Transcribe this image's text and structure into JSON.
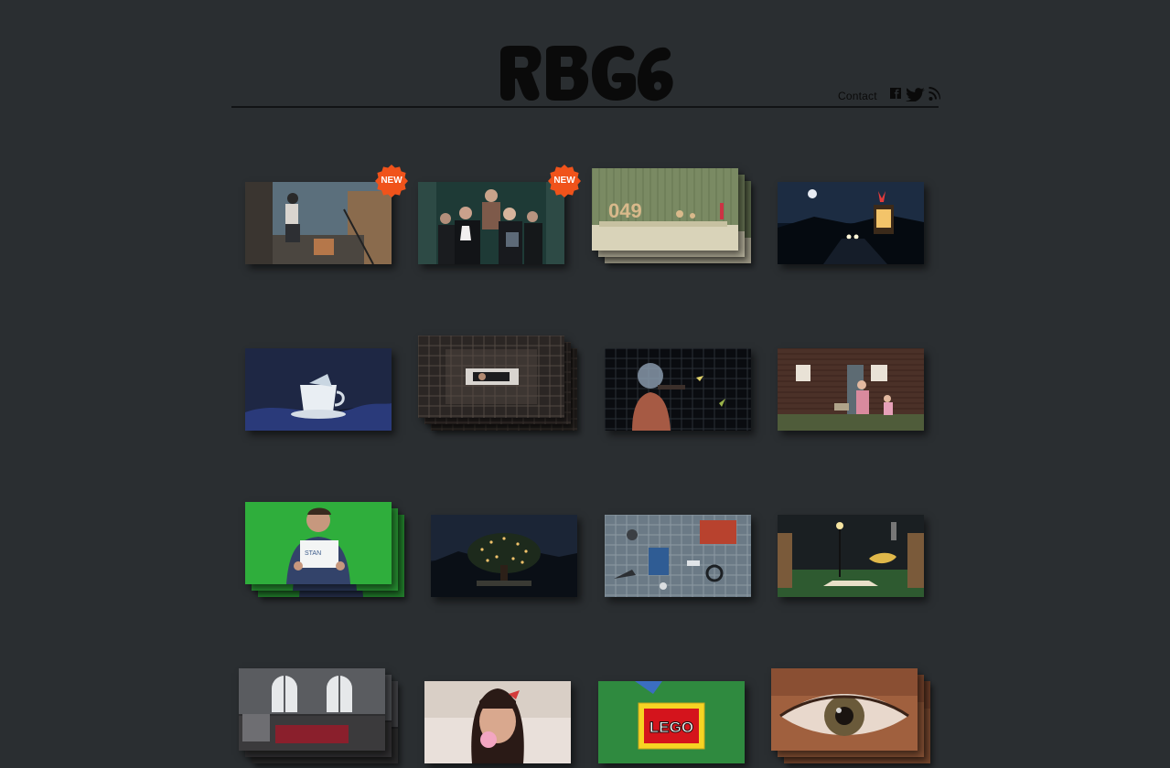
{
  "header": {
    "logo_alt": "RBG6",
    "contact_label": "Contact",
    "social": [
      {
        "name": "facebook-icon"
      },
      {
        "name": "twitter-icon"
      },
      {
        "name": "rss-icon"
      }
    ]
  },
  "badge_label": "NEW",
  "colors": {
    "background": "#2a2e31",
    "rule": "#111315",
    "badge": "#f0531b"
  },
  "thumbnails": [
    {
      "id": "thumb-1",
      "new": true,
      "stack": false,
      "scene": "window-painter"
    },
    {
      "id": "thumb-2",
      "new": true,
      "stack": false,
      "scene": "group-portrait"
    },
    {
      "id": "thumb-3",
      "new": false,
      "stack": true,
      "scene": "number-table"
    },
    {
      "id": "thumb-4",
      "new": false,
      "stack": false,
      "scene": "night-road"
    },
    {
      "id": "thumb-5",
      "new": false,
      "stack": false,
      "scene": "teacup"
    },
    {
      "id": "thumb-6",
      "new": false,
      "stack": true,
      "scene": "grid-room"
    },
    {
      "id": "thumb-7",
      "new": false,
      "stack": false,
      "scene": "diver-grid"
    },
    {
      "id": "thumb-8",
      "new": false,
      "stack": false,
      "scene": "family-house"
    },
    {
      "id": "thumb-9",
      "new": false,
      "stack": true,
      "scene": "green-screen-sign"
    },
    {
      "id": "thumb-10",
      "new": false,
      "stack": false,
      "scene": "night-tree"
    },
    {
      "id": "thumb-11",
      "new": false,
      "stack": false,
      "scene": "topdown-objects"
    },
    {
      "id": "thumb-12",
      "new": false,
      "stack": false,
      "scene": "streetlamp-lips"
    },
    {
      "id": "thumb-13",
      "new": false,
      "stack": true,
      "scene": "arched-windows"
    },
    {
      "id": "thumb-14",
      "new": false,
      "stack": false,
      "scene": "bubblegum-girl"
    },
    {
      "id": "thumb-15",
      "new": false,
      "stack": false,
      "scene": "lego-logo",
      "text": "LEGO"
    },
    {
      "id": "thumb-16",
      "new": false,
      "stack": true,
      "scene": "eye-closeup"
    }
  ]
}
